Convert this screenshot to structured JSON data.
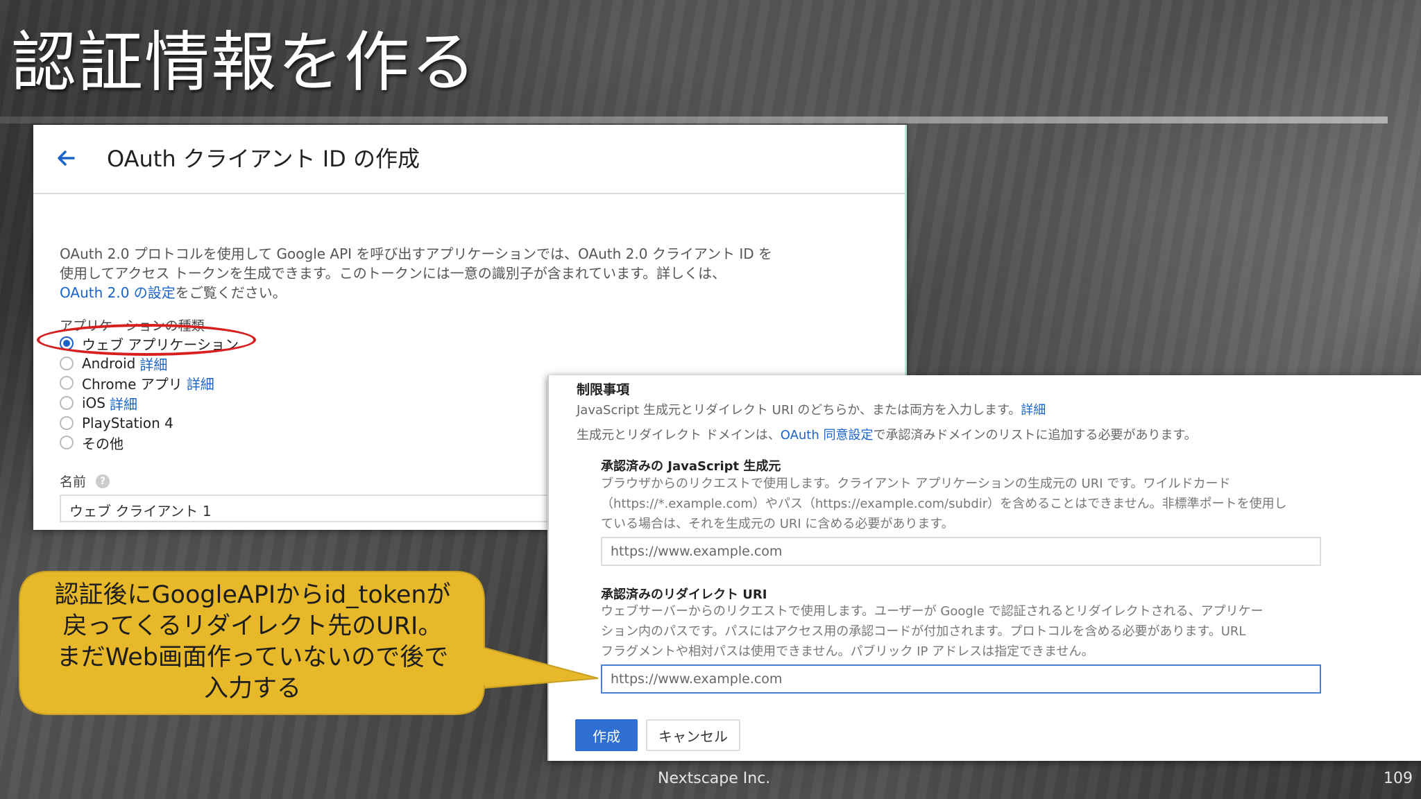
{
  "slide": {
    "title": "認証情報を作る",
    "footer_company": "Nextscape Inc.",
    "page_number": "109"
  },
  "panel1": {
    "title": "OAuth クライアント ID の作成",
    "description_lines": [
      "OAuth 2.0 プロトコルを使用して Google API を呼び出すアプリケーションでは、OAuth 2.0 クライアント ID を",
      "使用してアクセス トークンを生成できます。このトークンには一意の識別子が含まれています。詳しくは、"
    ],
    "description_link": "OAuth 2.0 の設定",
    "description_tail": "をご覧ください。",
    "app_type_label": "アプリケーションの種類",
    "app_types": [
      {
        "label": "ウェブ アプリケーション",
        "detail": "",
        "checked": true
      },
      {
        "label": "Android",
        "detail": "詳細",
        "checked": false
      },
      {
        "label": "Chrome アプリ",
        "detail": "詳細",
        "checked": false
      },
      {
        "label": "iOS",
        "detail": "詳細",
        "checked": false
      },
      {
        "label": "PlayStation 4",
        "detail": "",
        "checked": false
      },
      {
        "label": "その他",
        "detail": "",
        "checked": false
      }
    ],
    "name_label": "名前",
    "name_value": "ウェブ クライアント 1",
    "highlight_color": "#d81f1f"
  },
  "panel2": {
    "heading": "制限事項",
    "line1_text": "JavaScript 生成元とリダイレクト URI のどちらか、または両方を入力します。",
    "line1_link": "詳細",
    "line2_pre": "生成元とリダイレクト ドメインは、",
    "line2_link": "OAuth 同意設定",
    "line2_post": "で承認済みドメインのリストに追加する必要があります。",
    "js_origin_label": "承認済みの JavaScript 生成元",
    "js_origin_desc": [
      "ブラウザからのリクエストで使用します。クライアント アプリケーションの生成元の URI です。ワイルドカード",
      "（https://*.example.com）やパス（https://example.com/subdir）を含めることはできません。非標準ポートを使用し",
      "ている場合は、それを生成元の URI に含める必要があります。"
    ],
    "js_origin_placeholder": "https://www.example.com",
    "redirect_label": "承認済みのリダイレクト URI",
    "redirect_desc": [
      "ウェブサーバーからのリクエストで使用します。ユーザーが Google で認証されるとリダイレクトされる、アプリケー",
      "ション内のパスです。パスにはアクセス用の承認コードが付加されます。プロトコルを含める必要があります。URL",
      "フラグメントや相対パスは使用できません。パブリック IP アドレスは指定できません。"
    ],
    "redirect_placeholder": "https://www.example.com",
    "create_button": "作成",
    "cancel_button": "キャンセル",
    "accent_color": "#2f6fd3"
  },
  "callout": {
    "lines": [
      "認証後にGoogleAPIからid_tokenが",
      "戻ってくるリダイレクト先のURI。",
      "まだWeb画面作っていないので後で",
      "入力する"
    ],
    "fill_color": "#e6b82a"
  }
}
